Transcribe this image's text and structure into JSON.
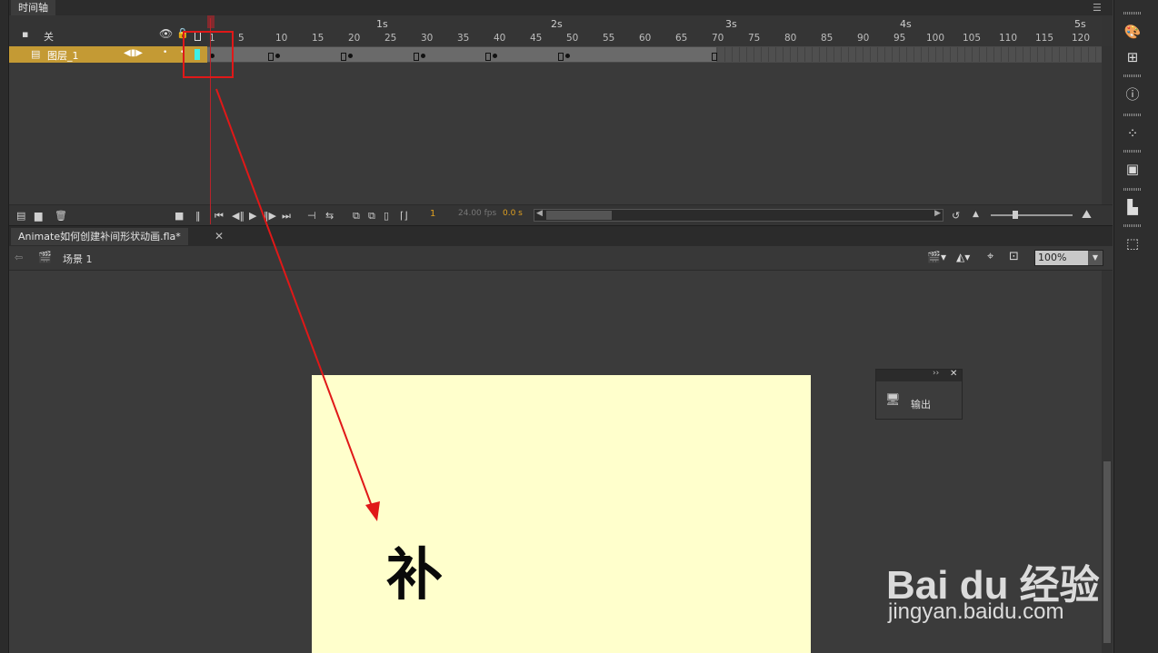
{
  "timeline": {
    "tab_label": "时间轴",
    "layer_column": {
      "label": "关"
    },
    "ruler": {
      "seconds": [
        "1s",
        "2s",
        "3s",
        "4s",
        "5s"
      ],
      "frame_numbers": [
        "1",
        "5",
        "10",
        "15",
        "20",
        "25",
        "30",
        "35",
        "40",
        "45",
        "50",
        "55",
        "60",
        "65",
        "70",
        "75",
        "80",
        "85",
        "90",
        "95",
        "100",
        "105",
        "110",
        "115",
        "120"
      ]
    },
    "layers": [
      {
        "name": "图层_1"
      }
    ],
    "footer": {
      "current_frame": "1",
      "fps": "24.00 fps",
      "time": "0.0 s"
    }
  },
  "document": {
    "tab_label": "Animate如何创建补间形状动画.fla*",
    "scene_label": "场景 1",
    "zoom": "100%",
    "stage_color": "#ffffcc",
    "stage_text": "补"
  },
  "output_panel": {
    "label": "输出"
  },
  "watermark": {
    "brand": "Bai du 经验",
    "url": "jingyan.baidu.com"
  },
  "colors": {
    "layer_highlight": "#c49a34",
    "playhead": "#b8232a",
    "annotation": "#e01818"
  }
}
